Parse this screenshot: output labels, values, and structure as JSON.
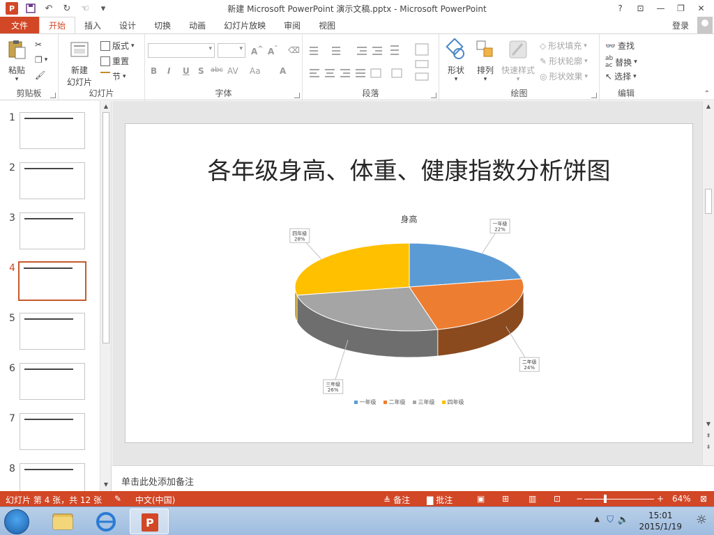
{
  "window": {
    "title": "新建 Microsoft PowerPoint 演示文稿.pptx - Microsoft PowerPoint",
    "app_logo": "P",
    "controls": [
      "?",
      "⊡",
      "—",
      "❐",
      "✕"
    ]
  },
  "qat": [
    "save-icon",
    "undo-icon",
    "redo-icon",
    "touch-mode-icon",
    "customize-icon"
  ],
  "tabs": [
    {
      "label": "文件",
      "kind": "file"
    },
    {
      "label": "开始",
      "kind": "active"
    },
    {
      "label": "插入"
    },
    {
      "label": "设计"
    },
    {
      "label": "切换"
    },
    {
      "label": "动画"
    },
    {
      "label": "幻灯片放映"
    },
    {
      "label": "审阅"
    },
    {
      "label": "视图"
    }
  ],
  "account": {
    "login_label": "登录"
  },
  "ribbon": {
    "clipboard": {
      "label": "剪贴板",
      "paste": "粘贴"
    },
    "slides": {
      "label": "幻灯片",
      "new_slide": "新建",
      "new_slide_2": "幻灯片",
      "layout": "版式",
      "reset": "重置",
      "section": "节"
    },
    "font": {
      "label": "字体",
      "buttons": [
        "B",
        "I",
        "U",
        "S",
        "abc",
        "AV",
        "Aa",
        "A"
      ]
    },
    "paragraph": {
      "label": "段落"
    },
    "drawing": {
      "label": "绘图",
      "shapes": "形状",
      "arrange": "排列",
      "quick_styles": "快速样式",
      "fill": "形状填充",
      "outline": "形状轮廓",
      "effects": "形状效果"
    },
    "editing": {
      "label": "编辑",
      "find": "查找",
      "replace": "替换",
      "select": "选择"
    }
  },
  "thumbnails": [
    {
      "num": "1"
    },
    {
      "num": "2"
    },
    {
      "num": "3"
    },
    {
      "num": "4",
      "active": true
    },
    {
      "num": "5"
    },
    {
      "num": "6"
    },
    {
      "num": "7"
    },
    {
      "num": "8"
    }
  ],
  "slide": {
    "title": "各年级身高、体重、健康指数分析饼图"
  },
  "chart_data": {
    "type": "pie",
    "title": "身高",
    "categories": [
      "一年级",
      "二年级",
      "三年级",
      "四年级"
    ],
    "values": [
      22,
      24,
      26,
      28
    ],
    "labels": [
      "22%",
      "24%",
      "26%",
      "28%"
    ],
    "colors": [
      "#5b9bd5",
      "#ed7d31",
      "#a5a5a5",
      "#ffc000"
    ],
    "side_colors": [
      "#3a6f9e",
      "#8a4a1e",
      "#6e6e6e",
      "#b58800"
    ],
    "legend_position": "bottom",
    "style": "3d"
  },
  "notes": {
    "placeholder": "单击此处添加备注"
  },
  "status": {
    "slide_info": "幻灯片 第 4 张，共 12 张",
    "language": "中文(中国)",
    "notes_btn": "备注",
    "comments_btn": "批注",
    "zoom": "64%"
  },
  "taskbar": {
    "time": "15:01",
    "date": "2015/1/19"
  }
}
